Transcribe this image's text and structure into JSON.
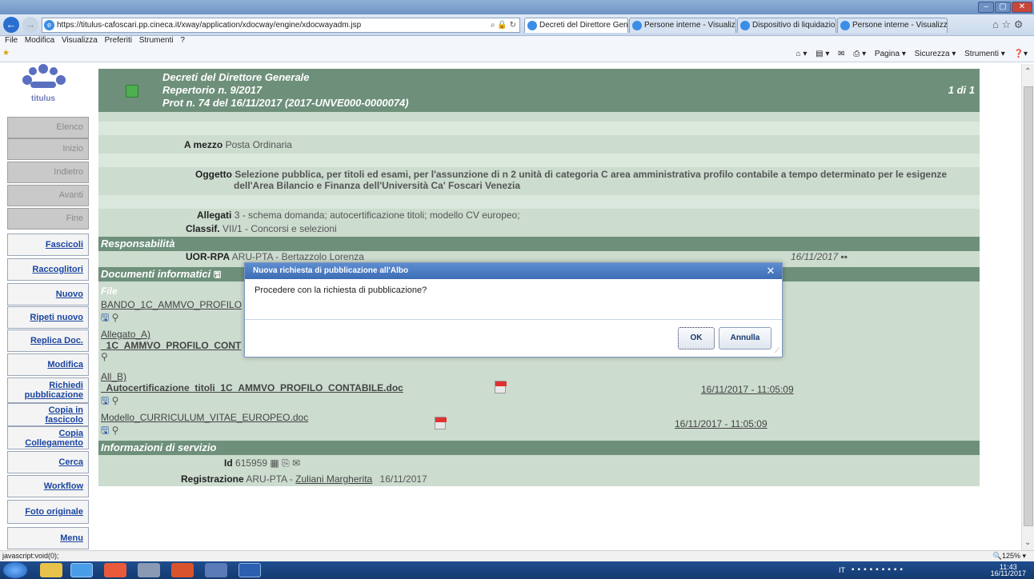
{
  "browser": {
    "url": "https://titulus-cafoscari.pp.cineca.it/xway/application/xdocway/engine/xdocwayadm.jsp",
    "tabs": [
      {
        "label": "Decreti del Direttore Genera..."
      },
      {
        "label": "Persone interne - Visualizzazio..."
      },
      {
        "label": "Dispositivo di liquidazione: Tra..."
      },
      {
        "label": "Persone interne - Visualizzazio..."
      }
    ],
    "menu": [
      "File",
      "Modifica",
      "Visualizza",
      "Preferiti",
      "Strumenti",
      "?"
    ],
    "tools": [
      "Pagina ▾",
      "Sicurezza ▾",
      "Strumenti ▾"
    ]
  },
  "sidebar": {
    "logo": "titulus",
    "nav": [
      "Elenco",
      "Inizio",
      "Indietro",
      "Avanti",
      "Fine"
    ],
    "actions": [
      "Fascicoli",
      "Raccoglitori",
      "Nuovo",
      "Ripeti nuovo",
      "Replica Doc.",
      "Modifica",
      "Richiedi pubblicazione",
      "Copia in fascicolo",
      "Copia Collegamento",
      "Cerca",
      "Workflow",
      "Foto originale",
      "Menu"
    ]
  },
  "document": {
    "title1": "Decreti del Direttore Generale",
    "title2": "Repertorio n. 9/2017",
    "title3": "Prot n. 74 del 16/11/2017  (2017-UNVE000-0000074)",
    "pager": "1 di 1",
    "mezzo_label": "A mezzo",
    "mezzo_value": "Posta Ordinaria",
    "oggetto_label": "Oggetto",
    "oggetto_value1": "Selezione pubblica, per titoli ed esami, per l'assunzione di n 2 unità di categoria C area amministrativa profilo contabile a tempo determinato per le esigenze",
    "oggetto_value2": "dell'Area Bilancio e Finanza dell'Università Ca' Foscari Venezia",
    "allegati_label": "Allegati",
    "allegati_value": "3 -  schema domanda; autocertificazione titoli; modello CV europeo;",
    "classif_label": "Classif.",
    "classif_value": "VII/1 - Concorsi e selezioni",
    "resp_section": "Responsabilità",
    "uor_label": "UOR-RPA",
    "uor_value": "ARU-PTA - Bertazzolo Lorenza",
    "uor_date": "16/11/2017",
    "docinf_section": "Documenti informatici",
    "file_label": "File",
    "files": [
      {
        "name": "BANDO_1C_AMMVO_PROFILO"
      },
      {
        "name1": "Allegato_A)",
        "name2": "_1C_AMMVO_PROFILO_CONT"
      },
      {
        "name1": "All_B)",
        "name2": "_Autocertificazione_titoli_1C_AMMVO_PROFILO_CONTABILE.doc",
        "date": "16/11/2017 - 11:05:09"
      },
      {
        "name": "Modello_CURRICULUM_VITAE_EUROPEO.doc",
        "date": "16/11/2017 - 11:05:09"
      }
    ],
    "servizio_section": "Informazioni di servizio",
    "id_label": "Id",
    "id_value": "615959",
    "reg_label": "Registrazione",
    "reg_value": "ARU-PTA -",
    "reg_user": "Zuliani Margherita",
    "reg_date": "16/11/2017"
  },
  "modal": {
    "title": "Nuova richiesta di pubblicazione all'Albo",
    "message": "Procedere con la richiesta di pubblicazione?",
    "ok": "OK",
    "cancel": "Annulla"
  },
  "status": {
    "text": "javascript:void(0);",
    "zoom": "125%"
  },
  "taskbar": {
    "lang": "IT",
    "time": "11:43",
    "date": "16/11/2017"
  }
}
